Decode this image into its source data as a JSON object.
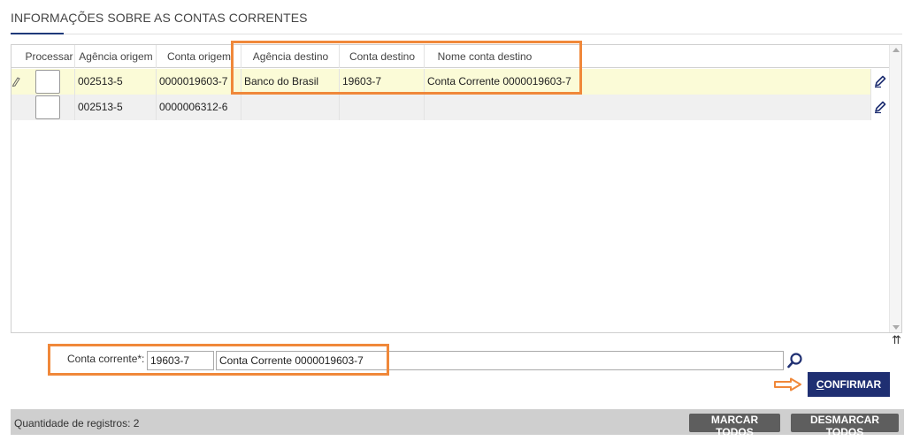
{
  "section": {
    "title": "INFORMAÇÕES SOBRE AS CONTAS CORRENTES"
  },
  "table": {
    "columns": [
      "Processar",
      "Agência origem",
      "Conta origem",
      "Agência destino",
      "Conta destino",
      "Nome conta destino"
    ],
    "rows": [
      {
        "agencia_origem": "002513-5",
        "conta_origem": "0000019603-7",
        "agencia_destino": "Banco do Brasil",
        "conta_destino": "19603-7",
        "nome_conta_destino": "Conta Corrente 0000019603-7"
      },
      {
        "agencia_origem": "002513-5",
        "conta_origem": "0000006312-6",
        "agencia_destino": "",
        "conta_destino": "",
        "nome_conta_destino": ""
      }
    ]
  },
  "form": {
    "conta_label": "Conta corrente*:",
    "conta_code": "19603-7",
    "conta_name": "Conta Corrente 0000019603-7"
  },
  "actions": {
    "confirm_first": "C",
    "confirm_rest": "ONFIRMAR"
  },
  "footer": {
    "count_label": "Quantidade de registros:",
    "count_value": "2",
    "select_all": "MARCAR TODOS",
    "deselect_all": "DESMARCAR TODOS"
  },
  "colors": {
    "highlight": "#f0883a",
    "primary": "#1f2f72",
    "row_selected": "#fbfbd7"
  }
}
